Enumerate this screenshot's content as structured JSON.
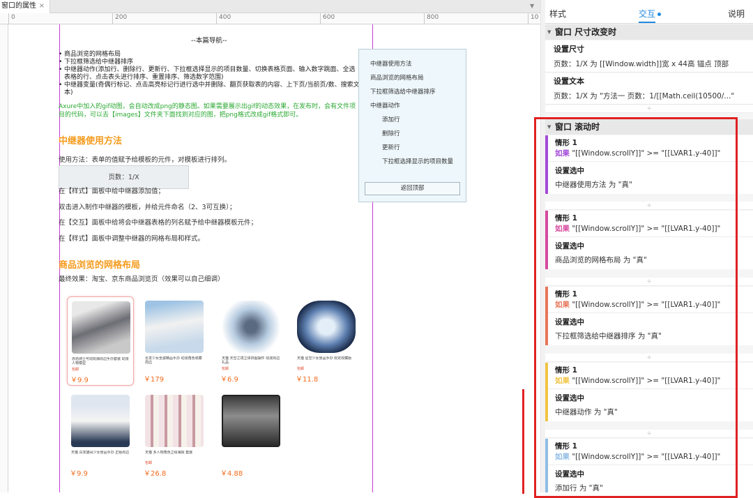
{
  "doc_tab": {
    "label": "窗口的属性",
    "close": "×"
  },
  "ruler": {
    "labels": [
      "0",
      "200",
      "400",
      "600",
      "800",
      "10"
    ]
  },
  "canvas": {
    "nav_title": "--本篇导航--",
    "nav_items": [
      "商品浏览的网格布局",
      "下拉框筛选给中继器排序",
      "中继器动作(添加行、删除行、更新行、下拉框选择显示的项目数量、切换表格页面、输入数字跳面、全选表格的行、点击表头进行排序、重置排序、筛选数字范围)",
      "中继器变量(奇偶行标记、点击高亮标记行进行选中并删除、翻页获取表的内容、上下页/当前页/数、搜索文本)"
    ],
    "tip": "Axure中加入的gif动图，会自动改成png的静态图。如果需要展示出gif的动态效果，在发布时，会有文件项目的代码，可以去【images】文件夹下面找到对应的图，把png格式改成gif格式即可。",
    "section1_title": "中继器使用方法",
    "usage": "使用方法：表单的值赋予给模板的元件，对模板进行排列。",
    "page_box": "页数：1/X",
    "step1": "在【样式】面板中给中继器添加值；",
    "step2": "双击进入制作中继器的模板，并给元件命名（2、3可互换）；",
    "step3": "在【交互】面板中给将会中继器表格的列名赋予给中继器模板元件；",
    "step4": "在【样式】面板中调整中继器的网格布局和样式。",
    "section2_title": "商品浏览的网格布局",
    "effect": "最终效果：淘宝、京东商品浏览页（效果可以自己细调）",
    "products": [
      {
        "desc": "赤焰骑士可动玩偶周边手办套装 动漫人物模型",
        "tag": "包邮",
        "price": "￥9.9"
      },
      {
        "desc": "长发少女坐姿精品手办 动漫角色收藏周边",
        "tag": "",
        "price": "￥179"
      },
      {
        "desc": "天猫 天空之境立体拼图摆件 动漫周边礼品",
        "tag": "包邮",
        "price": "￥6.9"
      },
      {
        "desc": "天猫 星空少女景品手办 限定收藏版",
        "tag": "包邮",
        "price": "￥11.8"
      },
      {
        "desc": "天猫 白发猫耳少女景品手办 正版周边",
        "tag": "",
        "price": "￥9.9"
      },
      {
        "desc": "天猫 多人物角色立绘海报 套装",
        "tag": "包邮",
        "price": "￥26.8"
      },
      {
        "desc": "",
        "tag": "",
        "price": "￥4.88"
      }
    ],
    "floatnav": {
      "items": [
        "中继器使用方法",
        "商品浏览的网格布局",
        "下拉框筛选给中继器排序",
        "中继器动作"
      ],
      "subitems": [
        "添加行",
        "删除行",
        "更新行",
        "下拉框选择显示的项目数量"
      ],
      "back": "返回顶部"
    }
  },
  "panel": {
    "tabs": [
      "样式",
      "交互",
      "说明"
    ],
    "active_tab": "交互",
    "resize_event": {
      "title": "窗口 尺寸改变时",
      "actions": [
        {
          "title": "设置尺寸",
          "value": "页数：1/X 为 [[Window.width]]宽 x 44高 锚点 顶部"
        },
        {
          "title": "设置文本",
          "value": "页数：1/X 为 \"方法一 页数：1/[[Math.ceil(10500/...\""
        }
      ]
    },
    "scroll_event": {
      "title": "窗口 滚动时",
      "cases": [
        {
          "name": "情形 1",
          "if": "如果",
          "condition": "\"[[Window.scrollY]]\" >= \"[[LVAR1.y-40]]\"",
          "action": "设置选中",
          "target": "中继器使用方法 为 \"真\"",
          "color": "#a34ad8"
        },
        {
          "name": "情形 1",
          "if": "如果",
          "condition": "\"[[Window.scrollY]]\" >= \"[[LVAR1.y-40]]\"",
          "action": "设置选中",
          "target": "商品浏览的网格布局 为 \"真\"",
          "color": "#d64a9e"
        },
        {
          "name": "情形 1",
          "if": "如果",
          "condition": "\"[[Window.scrollY]]\" >= \"[[LVAR1.y-40]]\"",
          "action": "设置选中",
          "target": "下拉框筛选给中继器排序 为 \"真\"",
          "color": "#e8765a"
        },
        {
          "name": "情形 1",
          "if": "如果",
          "condition": "\"[[Window.scrollY]]\" >= \"[[LVAR1.y-40]]\"",
          "action": "设置选中",
          "target": "中继器动作 为 \"真\"",
          "color": "#f2c443"
        },
        {
          "name": "情形 1",
          "if": "如果",
          "condition": "\"[[Window.scrollY]]\" >= \"[[LVAR1.y-40]]\"",
          "action": "设置选中",
          "target": "添加行 为 \"真\"",
          "color": "#8fbde6"
        }
      ]
    }
  },
  "colors": {
    "accent": "#1e8ae3",
    "highlight": "#e02121",
    "guide": "#c83bd8",
    "section_title": "#f59b1c",
    "tip": "#2aa832"
  }
}
